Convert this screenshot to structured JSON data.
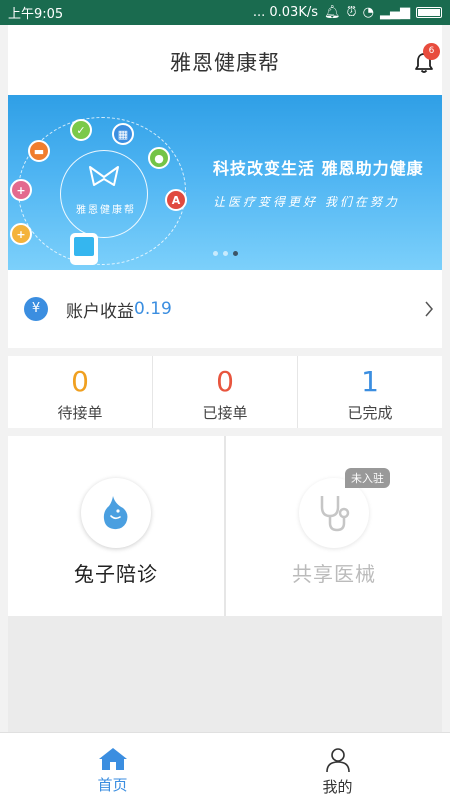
{
  "status_bar": {
    "time": "上午9:05",
    "network_speed": "... 0.03K/s"
  },
  "header": {
    "title": "雅恩健康帮",
    "notification_count": "6"
  },
  "banner": {
    "headline": "科技改变生活 雅恩助力健康",
    "slogan": "让医疗变得更好 我们在努力",
    "brand": "雅恩健康帮",
    "orbit_icons": [
      "pill-icon",
      "check-icon",
      "hospital-building-icon",
      "doctor-icon",
      "hospital-icon",
      "medical-kit-icon",
      "first-aid-icon"
    ],
    "slide_count": 3,
    "active_slide": 3
  },
  "account": {
    "label": "账户收益",
    "value": "0.19"
  },
  "stats": [
    {
      "value": "0",
      "label": "待接单",
      "color": "#f0a020"
    },
    {
      "value": "0",
      "label": "已接单",
      "color": "#e8553e"
    },
    {
      "value": "1",
      "label": "已完成",
      "color": "#3b8ee0"
    }
  ],
  "services": [
    {
      "name": "兔子陪诊",
      "icon": "rabbit-drop-icon",
      "enabled": true
    },
    {
      "name": "共享医械",
      "icon": "stethoscope-icon",
      "enabled": false,
      "tag": "未入驻"
    }
  ],
  "nav": {
    "home_label": "首页",
    "mine_label": "我的",
    "active": "home"
  },
  "colors": {
    "status_bar": "#1a6b4f",
    "accent": "#3b8ee0",
    "badge": "#e84c3d"
  }
}
